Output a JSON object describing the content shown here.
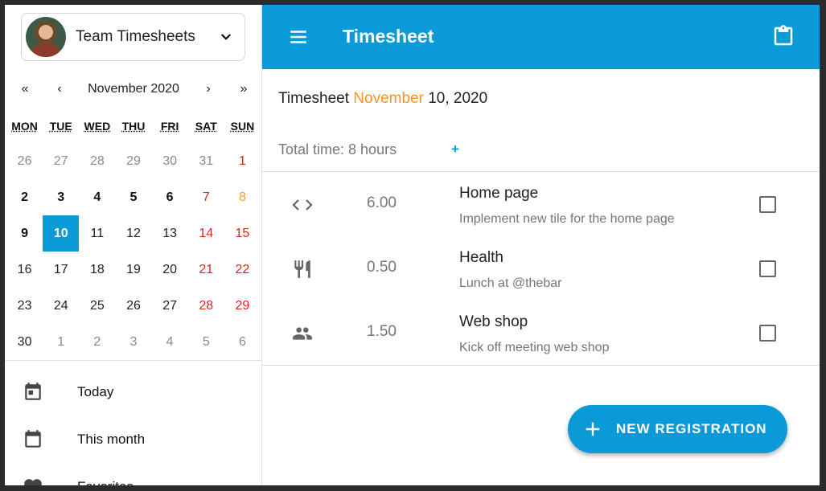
{
  "team": {
    "name": "Team Timesheets"
  },
  "calendar": {
    "nav": {
      "first": "«",
      "prev": "‹",
      "title": "November 2020",
      "next": "›",
      "last": "»"
    },
    "weekdays": [
      "MON",
      "TUE",
      "WED",
      "THU",
      "FRI",
      "SAT",
      "SUN"
    ],
    "weeks": [
      [
        {
          "d": "26",
          "s": "dim"
        },
        {
          "d": "27",
          "s": "dim"
        },
        {
          "d": "28",
          "s": "dim"
        },
        {
          "d": "29",
          "s": "dim"
        },
        {
          "d": "30",
          "s": "dim"
        },
        {
          "d": "31",
          "s": "dim"
        },
        {
          "d": "1",
          "s": "red"
        }
      ],
      [
        {
          "d": "2",
          "s": "bold"
        },
        {
          "d": "3",
          "s": "bold"
        },
        {
          "d": "4",
          "s": "bold"
        },
        {
          "d": "5",
          "s": "bold"
        },
        {
          "d": "6",
          "s": "bold"
        },
        {
          "d": "7",
          "s": "red"
        },
        {
          "d": "8",
          "s": "orange"
        }
      ],
      [
        {
          "d": "9",
          "s": "bold"
        },
        {
          "d": "10",
          "s": "sel"
        },
        {
          "d": "11",
          "s": "norm"
        },
        {
          "d": "12",
          "s": "norm"
        },
        {
          "d": "13",
          "s": "norm"
        },
        {
          "d": "14",
          "s": "red"
        },
        {
          "d": "15",
          "s": "red"
        }
      ],
      [
        {
          "d": "16",
          "s": "norm"
        },
        {
          "d": "17",
          "s": "norm"
        },
        {
          "d": "18",
          "s": "norm"
        },
        {
          "d": "19",
          "s": "norm"
        },
        {
          "d": "20",
          "s": "norm"
        },
        {
          "d": "21",
          "s": "red"
        },
        {
          "d": "22",
          "s": "red"
        }
      ],
      [
        {
          "d": "23",
          "s": "norm"
        },
        {
          "d": "24",
          "s": "norm"
        },
        {
          "d": "25",
          "s": "norm"
        },
        {
          "d": "26",
          "s": "norm"
        },
        {
          "d": "27",
          "s": "norm"
        },
        {
          "d": "28",
          "s": "red"
        },
        {
          "d": "29",
          "s": "red"
        }
      ],
      [
        {
          "d": "30",
          "s": "norm"
        },
        {
          "d": "1",
          "s": "dim"
        },
        {
          "d": "2",
          "s": "dim"
        },
        {
          "d": "3",
          "s": "dim"
        },
        {
          "d": "4",
          "s": "dim"
        },
        {
          "d": "5",
          "s": "dim"
        },
        {
          "d": "6",
          "s": "dim"
        }
      ]
    ]
  },
  "sidebar": {
    "items": [
      {
        "label": "Today",
        "icon": "calendar-today-icon"
      },
      {
        "label": "This month",
        "icon": "calendar-month-icon"
      },
      {
        "label": "Favorites",
        "icon": "heart-icon"
      }
    ]
  },
  "header": {
    "title": "Timesheet"
  },
  "summary": {
    "prefix": "Timesheet",
    "month": "November",
    "rest": "10, 2020",
    "total": "Total time: 8 hours",
    "add": "+"
  },
  "entries": [
    {
      "icon": "code-icon",
      "hours": "6.00",
      "project": "Home page",
      "description": "Implement new tile for the home page"
    },
    {
      "icon": "restaurant-icon",
      "hours": "0.50",
      "project": "Health",
      "description": "Lunch at @thebar"
    },
    {
      "icon": "people-icon",
      "hours": "1.50",
      "project": "Web shop",
      "description": "Kick off meeting web shop"
    }
  ],
  "fab": {
    "label": "NEW REGISTRATION"
  },
  "colors": {
    "primary": "#0a9ad8",
    "accent_month": "#f7941d",
    "weekend": "#e0231b",
    "holiday": "#f0a020"
  }
}
